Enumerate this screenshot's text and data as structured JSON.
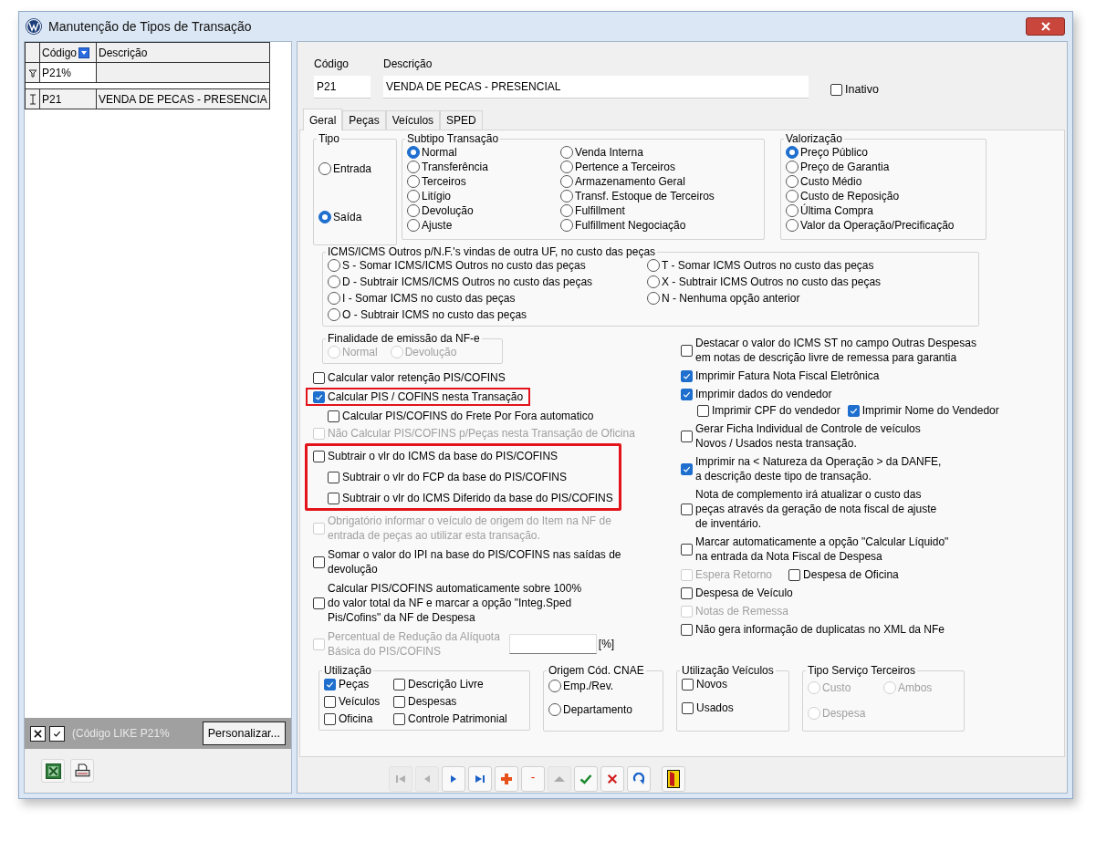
{
  "window": {
    "title": "Manutenção de Tipos de Transação"
  },
  "grid": {
    "columns": [
      "Código",
      "Descrição"
    ],
    "filter_value": "P21%",
    "rows": [
      {
        "cells": [
          "P21",
          "VENDA DE PECAS - PRESENCIA"
        ]
      }
    ]
  },
  "filter_bar": {
    "text": "(Código LIKE P21%",
    "button": "Personalizar..."
  },
  "header": {
    "code": {
      "label": "Código",
      "value": "P21"
    },
    "description": {
      "label": "Descrição",
      "value": "VENDA DE PECAS - PRESENCIAL"
    },
    "inactive": {
      "label": "Inativo",
      "checked": false
    }
  },
  "tabs": [
    {
      "label": "Geral",
      "selected": true
    },
    {
      "label": "Peças",
      "selected": false
    },
    {
      "label": "Veículos",
      "selected": false
    },
    {
      "label": "SPED",
      "selected": false
    }
  ],
  "tipo": {
    "title": "Tipo",
    "options": [
      {
        "label": "Entrada",
        "selected": false
      },
      {
        "label": "Saída",
        "selected": true
      }
    ]
  },
  "subtipo": {
    "title": "Subtipo Transação",
    "options": [
      {
        "label": "Normal",
        "selected": true
      },
      {
        "label": "Transferência",
        "selected": false
      },
      {
        "label": "Terceiros",
        "selected": false
      },
      {
        "label": "Litígio",
        "selected": false
      },
      {
        "label": "Devolução",
        "selected": false
      },
      {
        "label": "Ajuste",
        "selected": false
      },
      {
        "label": "Venda Interna",
        "selected": false
      },
      {
        "label": "Pertence a Terceiros",
        "selected": false
      },
      {
        "label": "Armazenamento Geral",
        "selected": false
      },
      {
        "label": "Transf. Estoque de Terceiros",
        "selected": false
      },
      {
        "label": "Fulfillment",
        "selected": false
      },
      {
        "label": "Fulfillment Negociação",
        "selected": false
      }
    ]
  },
  "valorizacao": {
    "title": "Valorização",
    "options": [
      {
        "label": "Preço Público",
        "selected": true
      },
      {
        "label": "Preço de Garantia",
        "selected": false
      },
      {
        "label": "Custo Médio",
        "selected": false
      },
      {
        "label": "Custo de Reposição",
        "selected": false
      },
      {
        "label": "Última Compra",
        "selected": false
      },
      {
        "label": "Valor da Operação/Precificação",
        "selected": false
      }
    ]
  },
  "icms": {
    "title": "ICMS/ICMS Outros p/N.F.'s vindas de outra UF, no custo das peças",
    "options": [
      {
        "label": "S - Somar ICMS/ICMS Outros no custo das peças",
        "selected": false
      },
      {
        "label": "T - Somar ICMS Outros no custo das peças",
        "selected": false
      },
      {
        "label": "D - Subtrair ICMS/ICMS Outros no custo das peças",
        "selected": false
      },
      {
        "label": "X - Subtrair ICMS Outros no custo das peças",
        "selected": false
      },
      {
        "label": "I - Somar ICMS no custo das peças",
        "selected": false
      },
      {
        "label": "N - Nenhuma opção anterior",
        "selected": false
      },
      {
        "label": "O - Subtrair ICMS no custo das peças",
        "selected": false
      }
    ]
  },
  "finalidade": {
    "title": "Finalidade de emissão da NF-e",
    "disabled": true,
    "options": [
      {
        "label": "Normal",
        "selected": false
      },
      {
        "label": "Devolução",
        "selected": false
      }
    ]
  },
  "left_options": [
    {
      "kind": "check",
      "label": "Calcular valor retenção PIS/COFINS",
      "checked": false,
      "disabled": false,
      "highlighted": false
    },
    {
      "kind": "check",
      "label": "Calcular PIS / COFINS nesta Transação",
      "checked": true,
      "disabled": false,
      "highlighted": true,
      "children": [
        {
          "label": "Calcular PIS/COFINS do Frete Por Fora automatico",
          "checked": false,
          "disabled": false
        }
      ]
    },
    {
      "kind": "check",
      "label": "Não Calcular PIS/COFINS p/Peças nesta Transação de Oficina",
      "checked": false,
      "disabled": true,
      "highlighted": false
    },
    {
      "kind": "group",
      "highlighted": true,
      "items": [
        {
          "label": "Subtrair o vlr do ICMS da base do PIS/COFINS",
          "checked": false,
          "disabled": false,
          "children": [
            {
              "label": "Subtrair o vlr do FCP da base do PIS/COFINS",
              "checked": false,
              "disabled": false
            },
            {
              "label": "Subtrair o vlr do ICMS Diferido da base do PIS/COFINS",
              "checked": false,
              "disabled": false
            }
          ]
        }
      ]
    },
    {
      "kind": "check",
      "label": "Obrigatório informar o veículo de origem do Item na NF de\nentrada de peças ao utilizar esta transação.",
      "checked": false,
      "disabled": true,
      "highlighted": false
    },
    {
      "kind": "check",
      "label": "Somar o valor do IPI na base do PIS/COFINS nas saídas de\ndevolução",
      "checked": false,
      "disabled": false,
      "highlighted": false
    },
    {
      "kind": "check",
      "label": "Calcular PIS/COFINS automaticamente sobre 100%\ndo valor total da NF e marcar a opção \"Integ.Sped\nPis/Cofins\" da NF de Despesa",
      "checked": false,
      "disabled": false,
      "highlighted": false
    },
    {
      "kind": "percent",
      "label": "Percentual de Redução da Alíquota\nBásica do PIS/COFINS",
      "checked": false,
      "disabled": true,
      "highlighted": false,
      "unit": "[%]"
    }
  ],
  "right_options": [
    {
      "kind": "check",
      "label": "Destacar o valor do ICMS ST no campo Outras Despesas\nem notas de descrição livre de remessa para garantia",
      "checked": false,
      "disabled": false
    },
    {
      "kind": "check",
      "label": "Imprimir Fatura Nota Fiscal Eletrônica",
      "checked": true,
      "disabled": false
    },
    {
      "kind": "check",
      "label": "Imprimir dados do vendedor",
      "checked": true,
      "disabled": false,
      "children": [
        {
          "label": "Imprimir CPF do vendedor",
          "checked": false,
          "disabled": false
        },
        {
          "label": "Imprimir Nome do Vendedor",
          "checked": true,
          "disabled": false
        }
      ]
    },
    {
      "kind": "check",
      "label": "Gerar Ficha Individual de Controle de veículos\nNovos / Usados  nesta transação.",
      "checked": false,
      "disabled": false
    },
    {
      "kind": "check",
      "label": "Imprimir na < Natureza da Operação > da DANFE,\na descrição deste tipo de transação.",
      "checked": true,
      "disabled": false
    },
    {
      "kind": "check",
      "label": "Nota de complemento irá atualizar o custo das\npeças através da geração de nota fiscal de ajuste\nde inventário.",
      "checked": false,
      "disabled": false
    },
    {
      "kind": "check",
      "label": "Marcar automaticamente a opção \"Calcular Líquido\"\nna entrada da Nota Fiscal de Despesa",
      "checked": false,
      "disabled": false
    },
    {
      "kind": "pair",
      "items": [
        {
          "label": "Espera Retorno",
          "checked": false,
          "disabled": true
        },
        {
          "label": "Despesa de Oficina",
          "checked": false,
          "disabled": false
        }
      ]
    },
    {
      "kind": "check",
      "label": "Despesa de Veículo",
      "checked": false,
      "disabled": false
    },
    {
      "kind": "check",
      "label": "Notas de Remessa",
      "checked": false,
      "disabled": true
    },
    {
      "kind": "check",
      "label": "Não gera informação de duplicatas no XML da NFe",
      "checked": false,
      "disabled": false
    }
  ],
  "utilizacao": {
    "title": "Utilização",
    "options": [
      {
        "label": "Peças",
        "checked": true
      },
      {
        "label": "Descrição Livre",
        "checked": false
      },
      {
        "label": "Veículos",
        "checked": false
      },
      {
        "label": "Despesas",
        "checked": false
      },
      {
        "label": "Oficina",
        "checked": false
      },
      {
        "label": "Controle Patrimonial",
        "checked": false
      }
    ]
  },
  "origem_cnae": {
    "title": "Origem Cód. CNAE",
    "options": [
      {
        "label": "Emp./Rev.",
        "selected": false
      },
      {
        "label": "Departamento",
        "selected": false
      }
    ]
  },
  "utilizacao_veiculos": {
    "title": "Utilização Veículos",
    "options": [
      {
        "label": "Novos",
        "checked": false
      },
      {
        "label": "Usados",
        "checked": false
      }
    ]
  },
  "tipo_servico": {
    "title": "Tipo Serviço Terceiros",
    "disabled": true,
    "options": [
      {
        "label": "Custo",
        "selected": false
      },
      {
        "label": "Ambos",
        "selected": false
      },
      {
        "label": "Despesa",
        "selected": false
      }
    ]
  },
  "toolbar": [
    {
      "kind": "first",
      "disabled": true
    },
    {
      "kind": "prev",
      "disabled": true
    },
    {
      "kind": "next",
      "disabled": false
    },
    {
      "kind": "last",
      "disabled": false
    },
    {
      "kind": "add",
      "disabled": false
    },
    {
      "kind": "remove",
      "disabled": false
    },
    {
      "kind": "up",
      "disabled": true
    },
    {
      "kind": "save",
      "disabled": false
    },
    {
      "kind": "cancel",
      "disabled": false
    },
    {
      "kind": "refresh",
      "disabled": false
    },
    {
      "kind": "exit",
      "disabled": false
    }
  ],
  "export_buttons": [
    {
      "kind": "excel"
    },
    {
      "kind": "print"
    }
  ]
}
